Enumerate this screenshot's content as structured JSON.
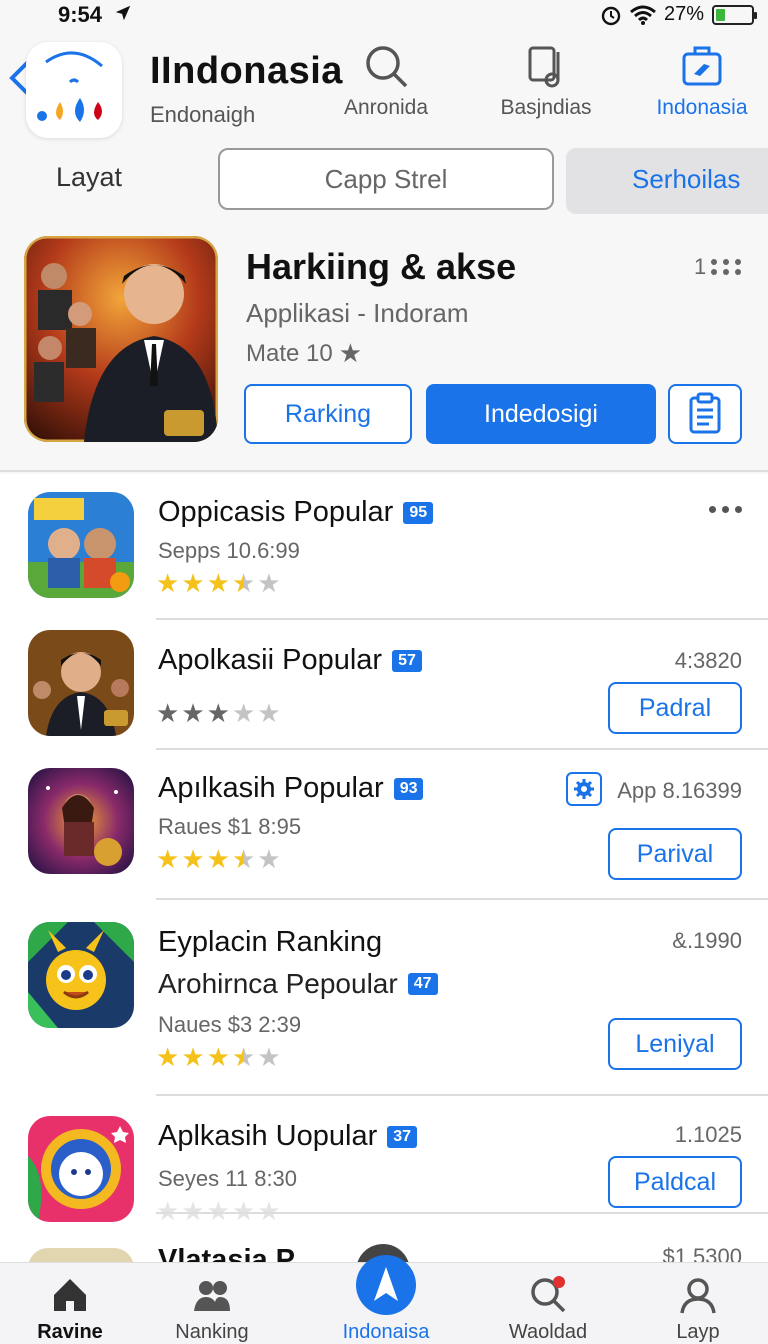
{
  "status_bar": {
    "time": "9:54",
    "battery_percent": "27%",
    "battery_level": 0.27
  },
  "header": {
    "title": "IIndonasia",
    "subtitle": "Endonaigh",
    "tabs": [
      {
        "label": "Anronida",
        "icon": "search-icon"
      },
      {
        "label": "Basjndias",
        "icon": "music-note-icon"
      },
      {
        "label": "Indonasia",
        "icon": "briefcase-icon",
        "active": true
      }
    ]
  },
  "filters": {
    "label": "Layat",
    "search_text": "Capp Strel",
    "segment_label": "Serhoilas"
  },
  "featured": {
    "title": "Harkiing & akse",
    "subtitle": "Applikasi - Indoram",
    "rating_text": "Mate 10",
    "count": "1",
    "button_outline": "Rarking",
    "button_primary": "Indedosigi"
  },
  "list": [
    {
      "title": "Oppicasis Popular",
      "badge": "95",
      "meta": "Sepps 10.6:99",
      "stars": 3.5,
      "star_style": "gold",
      "right_text": "",
      "button": "",
      "has_more": true
    },
    {
      "title": "Apolkasii Popular",
      "badge": "57",
      "meta": "",
      "stars": 3,
      "star_style": "dark",
      "right_text": "4:3820",
      "button": "Padral",
      "has_more": false
    },
    {
      "title": "Apılkasih Popular",
      "badge": "93",
      "meta": "Raues $1 8:95",
      "stars": 3.5,
      "star_style": "gold",
      "right_text": "App 8.16399",
      "button": "Parival",
      "has_gear": true
    },
    {
      "title": "Eyplacin Ranking",
      "subtitle": "Arohirnca Pepoular",
      "badge": "47",
      "meta": "Naues $3 2:39",
      "stars": 3.5,
      "star_style": "gold",
      "right_text": "&.1990",
      "button": "Leniyal"
    },
    {
      "title": "Aplkasih Uopular",
      "badge": "37",
      "meta": "Seyes 11 8:30",
      "stars": 0,
      "star_style": "faint",
      "right_text": "1.1025",
      "button": "Paldcal"
    },
    {
      "title": "Vlatasia P",
      "right_text": "$1 5300"
    }
  ],
  "tabbar": [
    {
      "label": "Ravine",
      "icon": "home-icon"
    },
    {
      "label": "Nanking",
      "icon": "people-icon"
    },
    {
      "label": "Indonaisa",
      "icon": "navigation-arrow-icon",
      "active": true
    },
    {
      "label": "Waoldad",
      "icon": "search-icon",
      "notification": "1"
    },
    {
      "label": "Layp",
      "icon": "profile-icon"
    }
  ]
}
